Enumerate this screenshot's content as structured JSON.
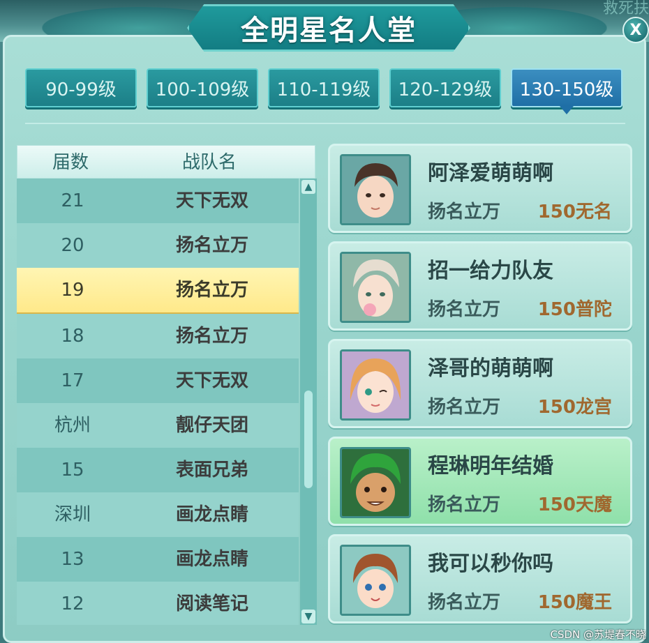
{
  "title": "全明星名人堂",
  "close_label": "X",
  "tabs": [
    {
      "label": "90-99级",
      "active": false
    },
    {
      "label": "100-109级",
      "active": false
    },
    {
      "label": "110-119级",
      "active": false
    },
    {
      "label": "120-129级",
      "active": false
    },
    {
      "label": "130-150级",
      "active": true
    }
  ],
  "table": {
    "headers": {
      "season": "届数",
      "team": "战队名"
    },
    "rows": [
      {
        "season": "21",
        "team": "天下无双"
      },
      {
        "season": "20",
        "team": "扬名立万"
      },
      {
        "season": "19",
        "team": "扬名立万",
        "selected": true
      },
      {
        "season": "18",
        "team": "扬名立万"
      },
      {
        "season": "17",
        "team": "天下无双"
      },
      {
        "season": "杭州",
        "team": "靓仔天团"
      },
      {
        "season": "15",
        "team": "表面兄弟"
      },
      {
        "season": "深圳",
        "team": "画龙点睛"
      },
      {
        "season": "13",
        "team": "画龙点睛"
      },
      {
        "season": "12",
        "team": "阅读笔记"
      }
    ]
  },
  "members": [
    {
      "name": "阿泽爱萌萌啊",
      "team": "扬名立万",
      "server": "150无名",
      "avatar": "male-hero-avatar"
    },
    {
      "name": "招一给力队友",
      "team": "扬名立万",
      "server": "150普陀",
      "avatar": "white-hair-avatar"
    },
    {
      "name": "泽哥的萌萌啊",
      "team": "扬名立万",
      "server": "150龙宫",
      "avatar": "girl-avatar"
    },
    {
      "name": "程琳明年结婚",
      "team": "扬名立万",
      "server": "150天魔",
      "avatar": "green-hair-avatar",
      "highlight": true
    },
    {
      "name": "我可以秒你吗",
      "team": "扬名立万",
      "server": "150魔王",
      "avatar": "child-avatar"
    }
  ],
  "watermark": "CSDN @苏堤春不晓",
  "corner_text": "救死扶"
}
